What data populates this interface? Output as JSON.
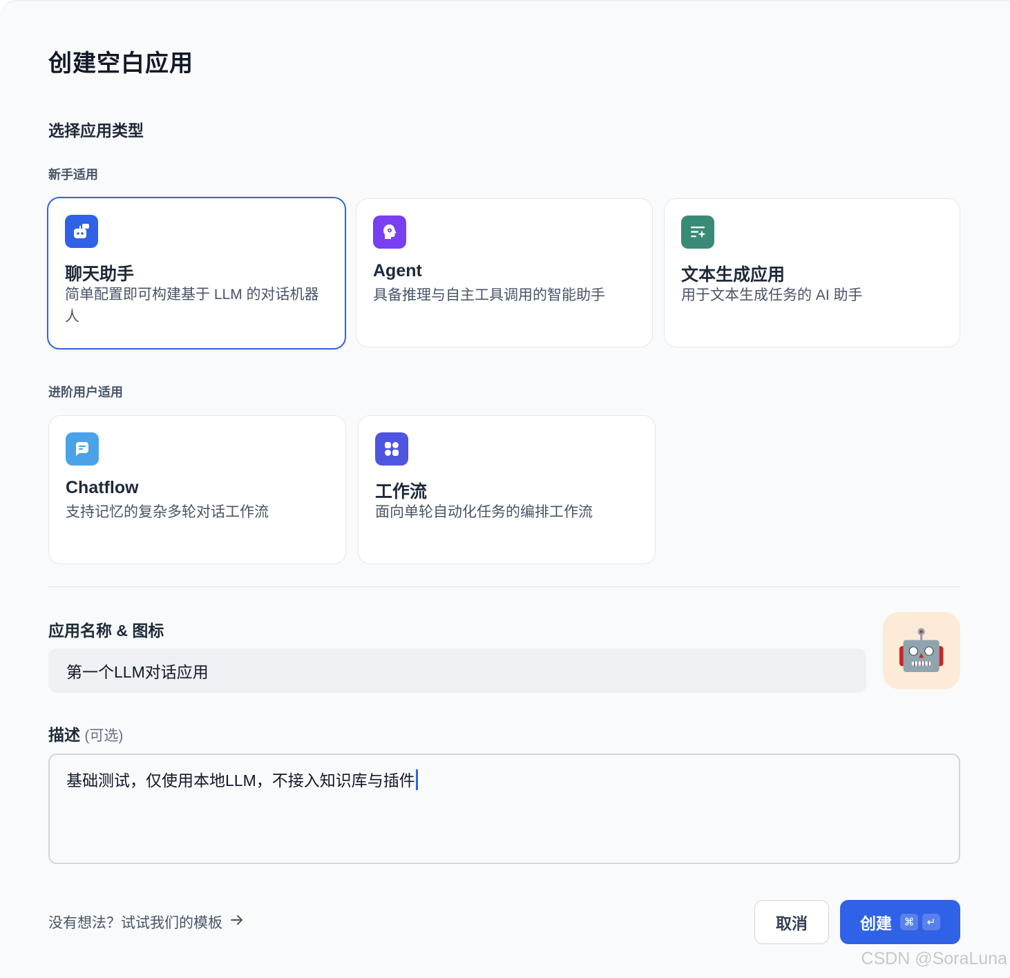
{
  "dialog": {
    "title": "创建空白应用",
    "section_title": "选择应用类型",
    "groups": [
      {
        "label": "新手适用",
        "cards": [
          {
            "name": "聊天助手",
            "desc": "简单配置即可构建基于 LLM 的对话机器人",
            "icon": "chatbot-icon",
            "color": "#2f62e6",
            "selected": true
          },
          {
            "name": "Agent",
            "desc": "具备推理与自主工具调用的智能助手",
            "icon": "agent-icon",
            "color": "#7a3ff0",
            "selected": false
          },
          {
            "name": "文本生成应用",
            "desc": "用于文本生成任务的 AI 助手",
            "icon": "text-generation-icon",
            "color": "#3a8a78",
            "selected": false
          }
        ]
      },
      {
        "label": "进阶用户适用",
        "cards": [
          {
            "name": "Chatflow",
            "desc": "支持记忆的复杂多轮对话工作流",
            "icon": "chatflow-icon",
            "color": "#4aa3e8",
            "selected": false
          },
          {
            "name": "工作流",
            "desc": "面向单轮自动化任务的编排工作流",
            "icon": "workflow-icon",
            "color": "#4f55e0",
            "selected": false
          }
        ]
      }
    ],
    "name_label": "应用名称 & 图标",
    "name_value": "第一个LLM对话应用",
    "app_icon": {
      "emoji": "🤖",
      "background": "#fdebd8"
    },
    "desc_label": "描述",
    "desc_optional": "(可选)",
    "desc_value": "基础测试，仅使用本地LLM，不接入知识库与插件",
    "template_link": "没有想法？试试我们的模板",
    "cancel_label": "取消",
    "create_label": "创建",
    "shortcut_keys": [
      "⌘",
      "↵"
    ]
  },
  "watermark": "CSDN @SoraLuna"
}
